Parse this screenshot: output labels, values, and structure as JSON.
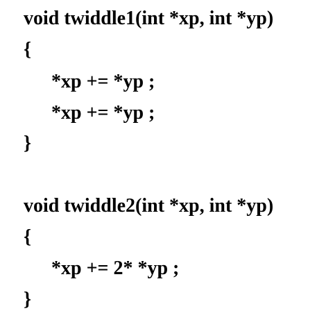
{
  "functions": [
    {
      "signature": "void twiddle1(int *xp, int *yp)",
      "open_brace": "{",
      "body": [
        "*xp += *yp ;",
        "*xp += *yp ;"
      ],
      "close_brace": "}"
    },
    {
      "signature": "void twiddle2(int *xp, int *yp)",
      "open_brace": "{",
      "body": [
        "*xp += 2* *yp ;"
      ],
      "close_brace": "}"
    }
  ],
  "colors": {
    "text": "#000000",
    "background": "#ffffff"
  }
}
